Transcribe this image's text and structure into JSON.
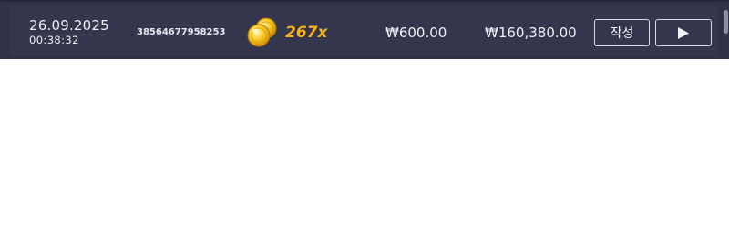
{
  "history_row": {
    "date": "26.09.2025",
    "time": "00:38:32",
    "round_id": "38564677958253",
    "multiplier": "267x",
    "multiplier_icon": "gold-coins-icon",
    "bet_amount": "₩600.00",
    "payout_amount": "₩160,380.00",
    "write_button_label": "작성",
    "play_button_icon": "play-icon"
  },
  "colors": {
    "panel_bg": "#2f3246",
    "row_bg": "#33364c",
    "multiplier_gold": "#f7b21b",
    "text": "#eef0f5"
  }
}
